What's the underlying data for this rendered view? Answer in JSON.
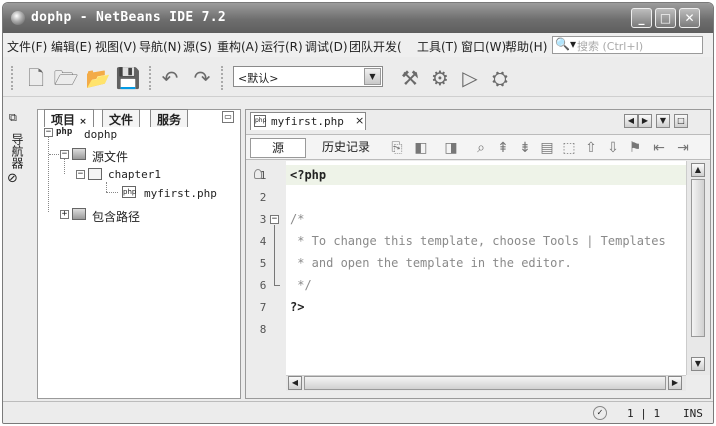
{
  "window": {
    "title": "dophp - NetBeans IDE 7.2"
  },
  "menu": [
    "文件(F)",
    "编辑(E)",
    "视图(V)",
    "导航(N)",
    "源(S)",
    "重构(A)",
    "运行(R)",
    "调试(D)",
    "团队开发(",
    "工具(T)",
    "窗口(W)",
    "帮助(H)"
  ],
  "search": {
    "placeholder": "搜索 (Ctrl+I)"
  },
  "toolbar": {
    "config_value": "<默认>"
  },
  "left_strip": {
    "label": "导航器"
  },
  "project_panel": {
    "tabs": [
      "项目",
      "文件",
      "服务"
    ],
    "tree": {
      "root": "dophp",
      "source_files": "源文件",
      "folder": "chapter1",
      "file": "myfirst.php",
      "include_path": "包含路径"
    }
  },
  "editor": {
    "tab_title": "myfirst.php",
    "view_tabs": [
      "源",
      "历史记录"
    ],
    "lines": [
      {
        "num": "1",
        "text": "<?php"
      },
      {
        "num": "2",
        "text": ""
      },
      {
        "num": "3",
        "text": "/*"
      },
      {
        "num": "4",
        "text": " * To change this template, choose Tools | Templates"
      },
      {
        "num": "5",
        "text": " * and open the template in the editor."
      },
      {
        "num": "6",
        "text": " */"
      },
      {
        "num": "7",
        "text": "?>"
      },
      {
        "num": "8",
        "text": ""
      }
    ]
  },
  "status": {
    "position": "1 | 1",
    "mode": "INS"
  }
}
